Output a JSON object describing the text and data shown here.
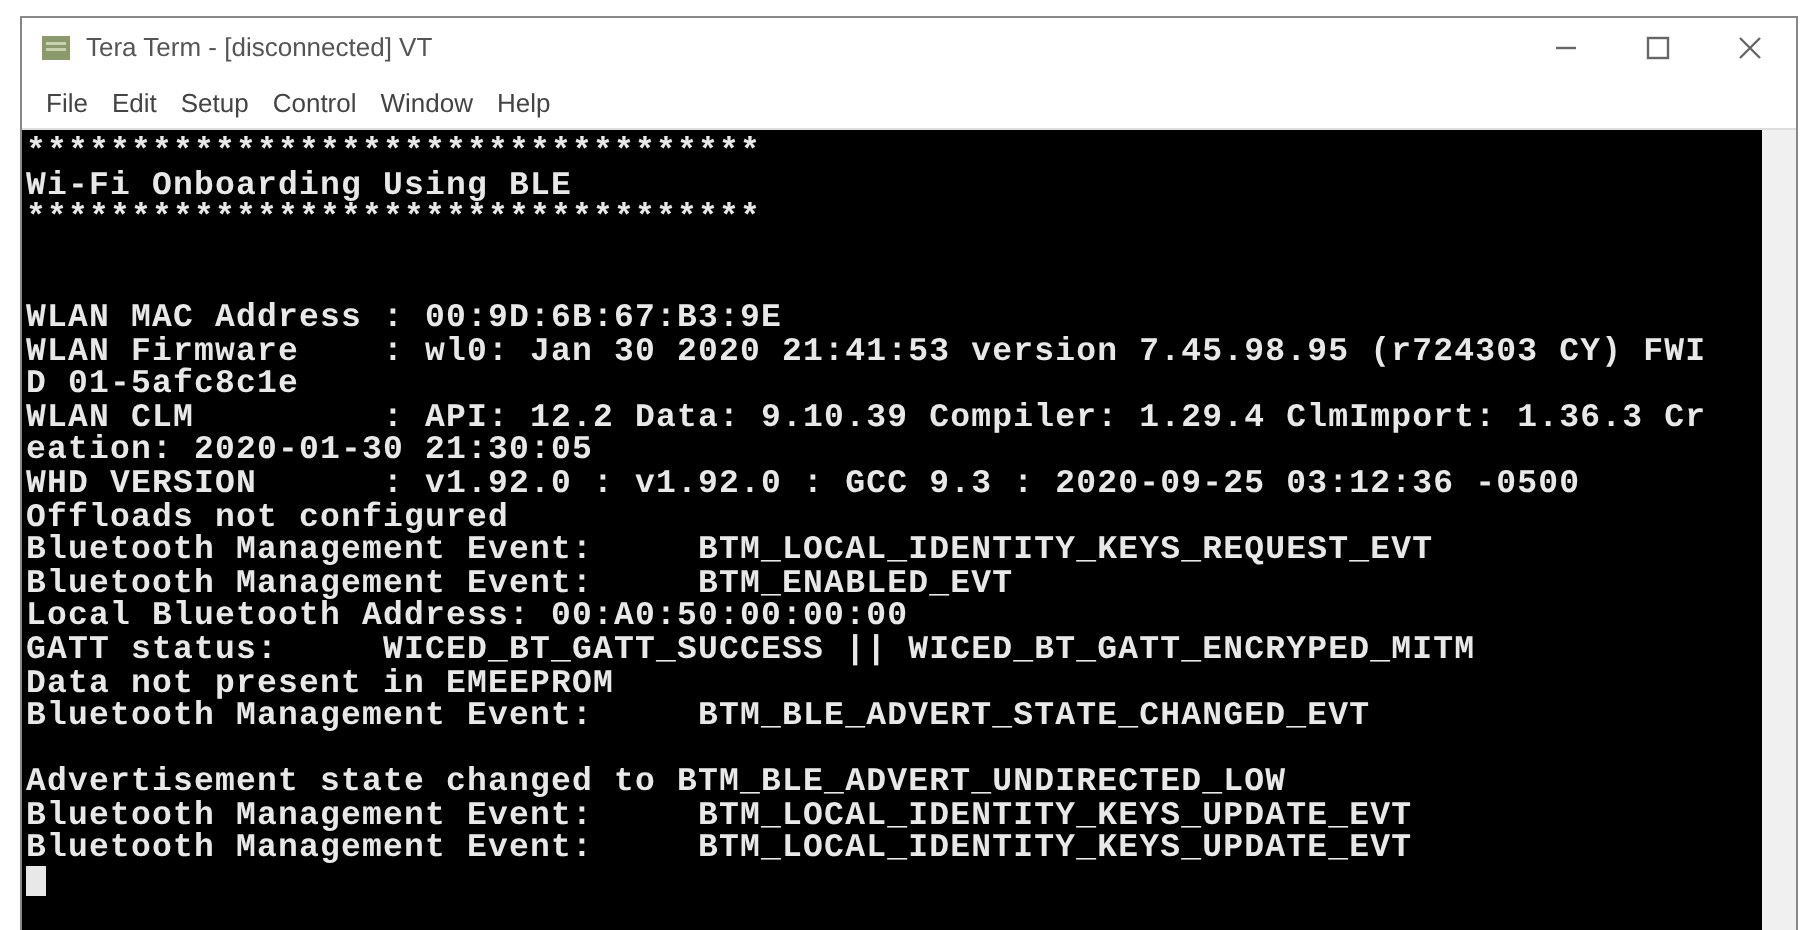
{
  "window": {
    "title": "Tera Term - [disconnected] VT"
  },
  "menu": [
    "File",
    "Edit",
    "Setup",
    "Control",
    "Window",
    "Help"
  ],
  "terminal": {
    "cursor_visible": true,
    "lines": [
      {
        "kind": "text",
        "text": "***********************************"
      },
      {
        "kind": "text",
        "text": "Wi-Fi Onboarding Using BLE"
      },
      {
        "kind": "text",
        "text": "***********************************"
      },
      {
        "kind": "blank"
      },
      {
        "kind": "blank"
      },
      {
        "kind": "text",
        "text": "WLAN MAC Address : 00:9D:6B:67:B3:9E"
      },
      {
        "kind": "text",
        "text": "WLAN Firmware    : wl0: Jan 30 2020 21:41:53 version 7.45.98.95 (r724303 CY) FWI"
      },
      {
        "kind": "text",
        "text": "D 01-5afc8c1e"
      },
      {
        "kind": "text",
        "text": "WLAN CLM         : API: 12.2 Data: 9.10.39 Compiler: 1.29.4 ClmImport: 1.36.3 Cr"
      },
      {
        "kind": "text",
        "text": "eation: 2020-01-30 21:30:05"
      },
      {
        "kind": "text",
        "text": "WHD VERSION      : v1.92.0 : v1.92.0 : GCC 9.3 : 2020-09-25 03:12:36 -0500"
      },
      {
        "kind": "text",
        "text": "Offloads not configured"
      },
      {
        "kind": "text",
        "text": "Bluetooth Management Event:     BTM_LOCAL_IDENTITY_KEYS_REQUEST_EVT"
      },
      {
        "kind": "text",
        "text": "Bluetooth Management Event:     BTM_ENABLED_EVT"
      },
      {
        "kind": "text",
        "text": "Local Bluetooth Address: 00:A0:50:00:00:00"
      },
      {
        "kind": "text",
        "text": "GATT status:     WICED_BT_GATT_SUCCESS || WICED_BT_GATT_ENCRYPED_MITM"
      },
      {
        "kind": "text",
        "text": "Data not present in EMEEPROM"
      },
      {
        "kind": "text",
        "text": "Bluetooth Management Event:     BTM_BLE_ADVERT_STATE_CHANGED_EVT"
      },
      {
        "kind": "blank"
      },
      {
        "kind": "text",
        "text": "Advertisement state changed to BTM_BLE_ADVERT_UNDIRECTED_LOW"
      },
      {
        "kind": "text",
        "text": "Bluetooth Management Event:     BTM_LOCAL_IDENTITY_KEYS_UPDATE_EVT"
      },
      {
        "kind": "text",
        "text": "Bluetooth Management Event:     BTM_LOCAL_IDENTITY_KEYS_UPDATE_EVT"
      }
    ]
  }
}
